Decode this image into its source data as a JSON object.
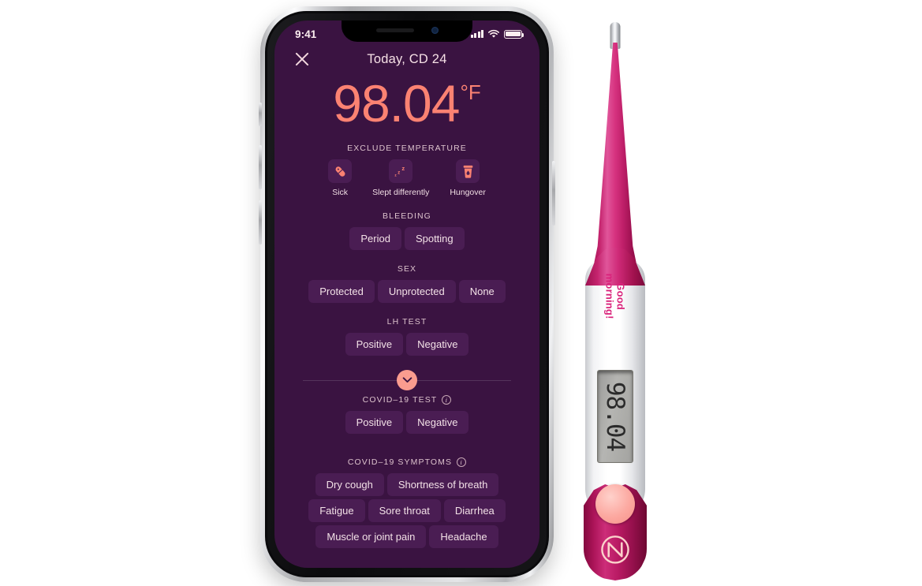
{
  "phone": {
    "status_bar": {
      "time": "9:41",
      "signal_icon": "signal-bars-icon",
      "wifi_icon": "wifi-icon",
      "battery_icon": "battery-icon"
    }
  },
  "app": {
    "nav": {
      "close_icon": "close-icon",
      "title": "Today, CD 24"
    },
    "temperature": {
      "value": "98.04",
      "unit": "°F",
      "color": "#fb8272"
    },
    "exclude": {
      "label": "EXCLUDE TEMPERATURE",
      "items": [
        {
          "icon": "pill-icon",
          "label": "Sick"
        },
        {
          "icon": "sleep-zzz-icon",
          "label": "Slept differently"
        },
        {
          "icon": "drink-cup-icon",
          "label": "Hungover"
        }
      ]
    },
    "bleeding": {
      "label": "BLEEDING",
      "options": [
        "Period",
        "Spotting"
      ]
    },
    "sex": {
      "label": "SEX",
      "options": [
        "Protected",
        "Unprotected",
        "None"
      ]
    },
    "lh_test": {
      "label": "LH TEST",
      "options": [
        "Positive",
        "Negative"
      ]
    },
    "expander": {
      "icon": "chevron-down-icon"
    },
    "covid_test": {
      "label": "COVID–19 TEST",
      "info_icon": "info-icon",
      "options": [
        "Positive",
        "Negative"
      ]
    },
    "covid_symptoms": {
      "label": "COVID–19 SYMPTOMS",
      "info_icon": "info-icon",
      "options": [
        "Dry cough",
        "Shortness of breath",
        "Fatigue",
        "Sore throat",
        "Diarrhea",
        "Muscle or joint pain",
        "Headache"
      ]
    },
    "colors": {
      "background": "#3a1341",
      "chip": "#4a1d53",
      "accent": "#fb8272",
      "text": "#f3e1e7"
    }
  },
  "thermometer": {
    "greeting": "Good\nmorning!",
    "display_value": "98.04",
    "brand_logo": "natural-cycles-n-logo",
    "colors": {
      "pink": "#c4236d",
      "white": "#ffffff",
      "button": "#fca8a0"
    }
  }
}
